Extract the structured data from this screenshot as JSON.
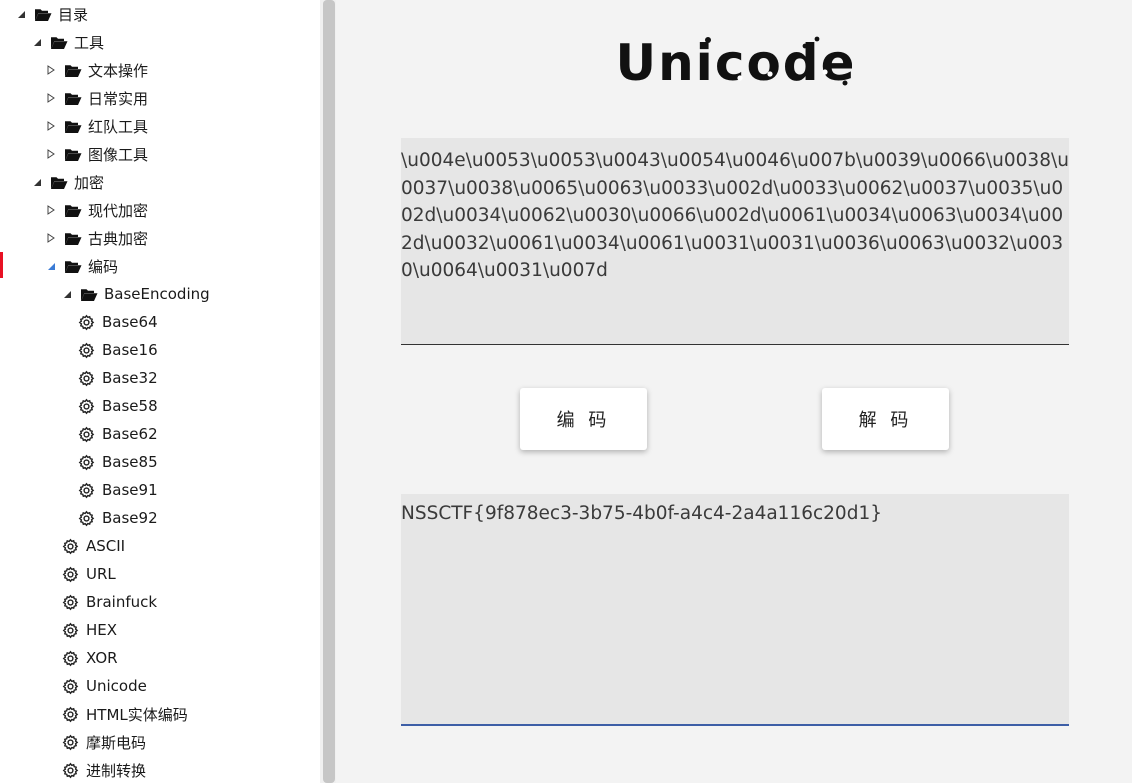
{
  "tree": {
    "items": [
      {
        "label": "目录",
        "icon": "folder-open-icon",
        "expander": "expanded",
        "level": 0
      },
      {
        "label": "工具",
        "icon": "folder-open-icon",
        "expander": "expanded",
        "level": 1
      },
      {
        "label": "文本操作",
        "icon": "folder-open-icon",
        "expander": "collapsed",
        "level": 2
      },
      {
        "label": "日常实用",
        "icon": "folder-open-icon",
        "expander": "collapsed",
        "level": 2
      },
      {
        "label": "红队工具",
        "icon": "folder-open-icon",
        "expander": "collapsed",
        "level": 2
      },
      {
        "label": "图像工具",
        "icon": "folder-open-icon",
        "expander": "collapsed",
        "level": 2
      },
      {
        "label": "加密",
        "icon": "folder-open-icon",
        "expander": "expanded",
        "level": 1
      },
      {
        "label": "现代加密",
        "icon": "folder-open-icon",
        "expander": "collapsed",
        "level": 2
      },
      {
        "label": "古典加密",
        "icon": "folder-open-icon",
        "expander": "collapsed",
        "level": 2
      },
      {
        "label": "编码",
        "icon": "folder-open-icon",
        "expander": "expanded",
        "level": 2
      },
      {
        "label": "BaseEncoding",
        "icon": "folder-open-icon",
        "expander": "expanded",
        "level": 3
      },
      {
        "label": "Base64",
        "icon": "gear-icon",
        "expander": "none",
        "level": 4
      },
      {
        "label": "Base16",
        "icon": "gear-icon",
        "expander": "none",
        "level": 4
      },
      {
        "label": "Base32",
        "icon": "gear-icon",
        "expander": "none",
        "level": 4
      },
      {
        "label": "Base58",
        "icon": "gear-icon",
        "expander": "none",
        "level": 4
      },
      {
        "label": "Base62",
        "icon": "gear-icon",
        "expander": "none",
        "level": 4
      },
      {
        "label": "Base85",
        "icon": "gear-icon",
        "expander": "none",
        "level": 4
      },
      {
        "label": "Base91",
        "icon": "gear-icon",
        "expander": "none",
        "level": 4
      },
      {
        "label": "Base92",
        "icon": "gear-icon",
        "expander": "none",
        "level": 4
      },
      {
        "label": "ASCII",
        "icon": "gear-icon",
        "expander": "none",
        "level": 3
      },
      {
        "label": "URL",
        "icon": "gear-icon",
        "expander": "none",
        "level": 3
      },
      {
        "label": "Brainfuck",
        "icon": "gear-icon",
        "expander": "none",
        "level": 3
      },
      {
        "label": "HEX",
        "icon": "gear-icon",
        "expander": "none",
        "level": 3
      },
      {
        "label": "XOR",
        "icon": "gear-icon",
        "expander": "none",
        "level": 3
      },
      {
        "label": "Unicode",
        "icon": "gear-icon",
        "expander": "none",
        "level": 3
      },
      {
        "label": "HTML实体编码",
        "icon": "gear-icon",
        "expander": "none",
        "level": 3
      },
      {
        "label": "摩斯电码",
        "icon": "gear-icon",
        "expander": "none",
        "level": 3
      },
      {
        "label": "进制转换",
        "icon": "gear-icon",
        "expander": "none",
        "level": 3
      }
    ]
  },
  "main": {
    "title": "Unicode",
    "input_value": "\\u004e\\u0053\\u0053\\u0043\\u0054\\u0046\\u007b\\u0039\\u0066\\u0038\\u0037\\u0038\\u0065\\u0063\\u0033\\u002d\\u0033\\u0062\\u0037\\u0035\\u002d\\u0034\\u0062\\u0030\\u0066\\u002d\\u0061\\u0034\\u0063\\u0034\\u002d\\u0032\\u0061\\u0034\\u0061\\u0031\\u0031\\u0036\\u0063\\u0032\\u0030\\u0064\\u0031\\u007d",
    "encode_label": "编 码",
    "decode_label": "解 码",
    "output_value": "NSSCTF{9f878ec3-3b75-4b0f-a4c4-2a4a116c20d1}"
  },
  "colors": {
    "selection_marker": "#e81123",
    "output_focus_underline": "#3d5ea6",
    "textbox_bg": "#e6e6e6"
  }
}
